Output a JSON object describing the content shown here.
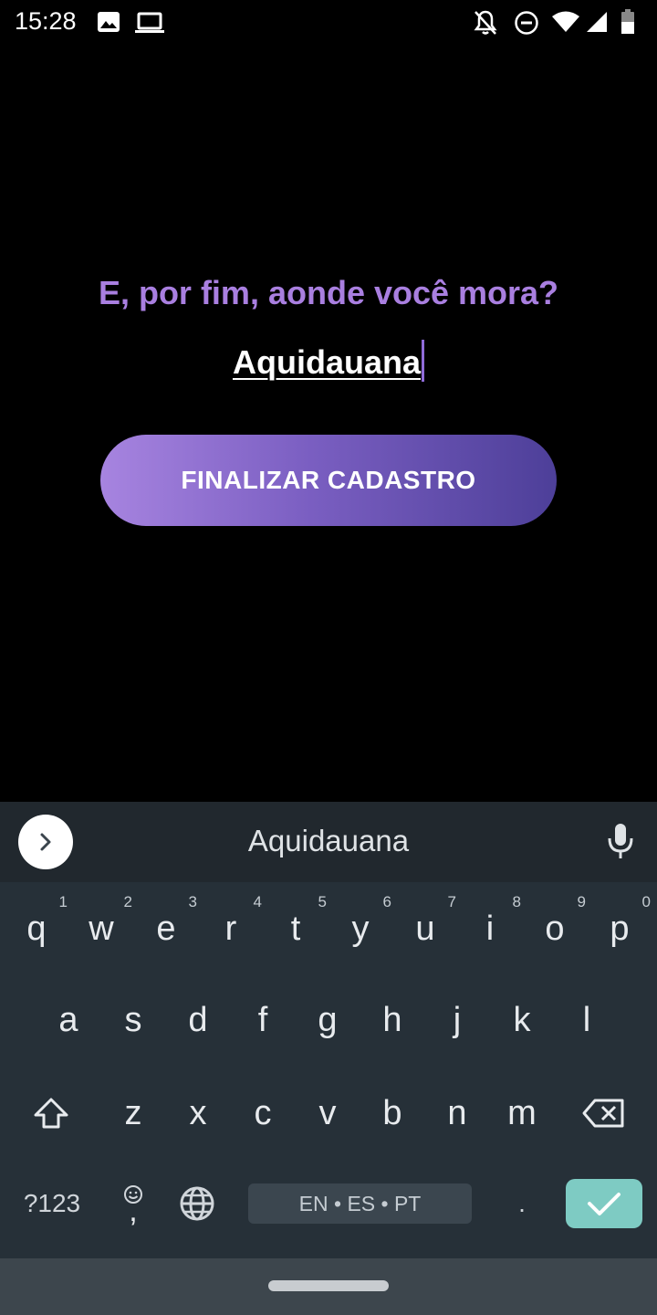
{
  "status_bar": {
    "time": "15:28",
    "icons": [
      "image-icon",
      "laptop-icon",
      "notifications-off-icon",
      "do-not-disturb-icon",
      "wifi-icon",
      "signal-icon",
      "battery-icon"
    ]
  },
  "form": {
    "question": "E, por fim, aonde você mora?",
    "answer_value": "Aquidauana",
    "finish_button_label": "FINALIZAR CADASTRO"
  },
  "keyboard": {
    "suggestion": "Aquidauana",
    "row1": [
      {
        "key": "q",
        "hint": "1"
      },
      {
        "key": "w",
        "hint": "2"
      },
      {
        "key": "e",
        "hint": "3"
      },
      {
        "key": "r",
        "hint": "4"
      },
      {
        "key": "t",
        "hint": "5"
      },
      {
        "key": "y",
        "hint": "6"
      },
      {
        "key": "u",
        "hint": "7"
      },
      {
        "key": "i",
        "hint": "8"
      },
      {
        "key": "o",
        "hint": "9"
      },
      {
        "key": "p",
        "hint": "0"
      }
    ],
    "row2": [
      "a",
      "s",
      "d",
      "f",
      "g",
      "h",
      "j",
      "k",
      "l"
    ],
    "row3": [
      "z",
      "x",
      "c",
      "v",
      "b",
      "n",
      "m"
    ],
    "symbols_label": "?123",
    "comma_label": ",",
    "period_label": ".",
    "space_label": "EN • ES • PT"
  },
  "colors": {
    "question": "#a97fe0",
    "button_gradient_start": "#a784e0",
    "button_gradient_end": "#4d3f99",
    "keyboard_bg": "#263038",
    "enter_key": "#7ecbc3"
  }
}
